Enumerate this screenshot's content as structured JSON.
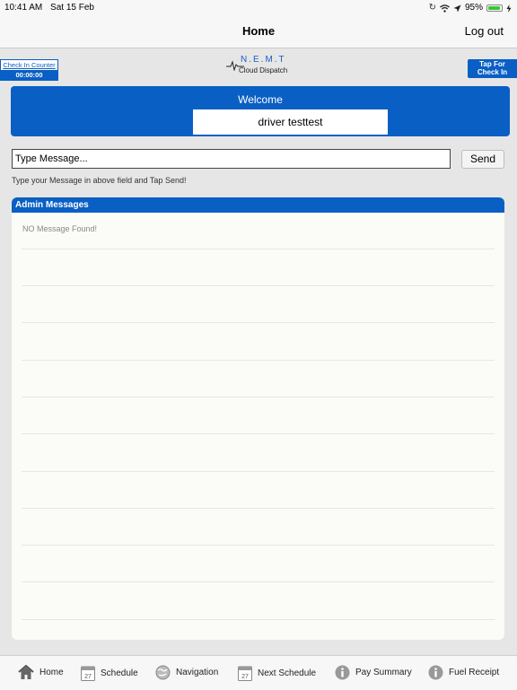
{
  "status_bar": {
    "time": "10:41 AM",
    "date": "Sat 15 Feb",
    "battery": "95%",
    "icons": [
      "sync-icon",
      "wifi-icon",
      "location-arrow-icon",
      "battery-icon",
      "charging-bolt-icon"
    ],
    "battery_color": "#37c837"
  },
  "nav": {
    "title": "Home",
    "logout_label": "Log out"
  },
  "header": {
    "check_in_counter_label": "Check In Counter",
    "check_in_counter_value": "00:00:00",
    "logo_top": "N.E.M.T",
    "logo_bottom": "Cloud Dispatch",
    "tap_check_in_line1": "Tap For",
    "tap_check_in_line2": "Check In"
  },
  "welcome": {
    "title": "Welcome",
    "driver_name": "driver testtest"
  },
  "message": {
    "placeholder": "Type Message...",
    "send_label": "Send",
    "hint": "Type your Message in above field and Tap Send!"
  },
  "admin_messages": {
    "header": "Admin Messages",
    "empty_text": "NO Message Found!"
  },
  "tabs": [
    {
      "label": "Home",
      "icon": "home-icon"
    },
    {
      "label": "Schedule",
      "icon": "calendar-icon"
    },
    {
      "label": "Navigation",
      "icon": "globe-icon"
    },
    {
      "label": "Next Schedule",
      "icon": "calendar-icon"
    },
    {
      "label": "Pay Summary",
      "icon": "info-icon"
    },
    {
      "label": "Fuel Receipt",
      "icon": "info-icon"
    }
  ],
  "colors": {
    "accent": "#0a5fc4",
    "background": "#e6e6e6"
  }
}
